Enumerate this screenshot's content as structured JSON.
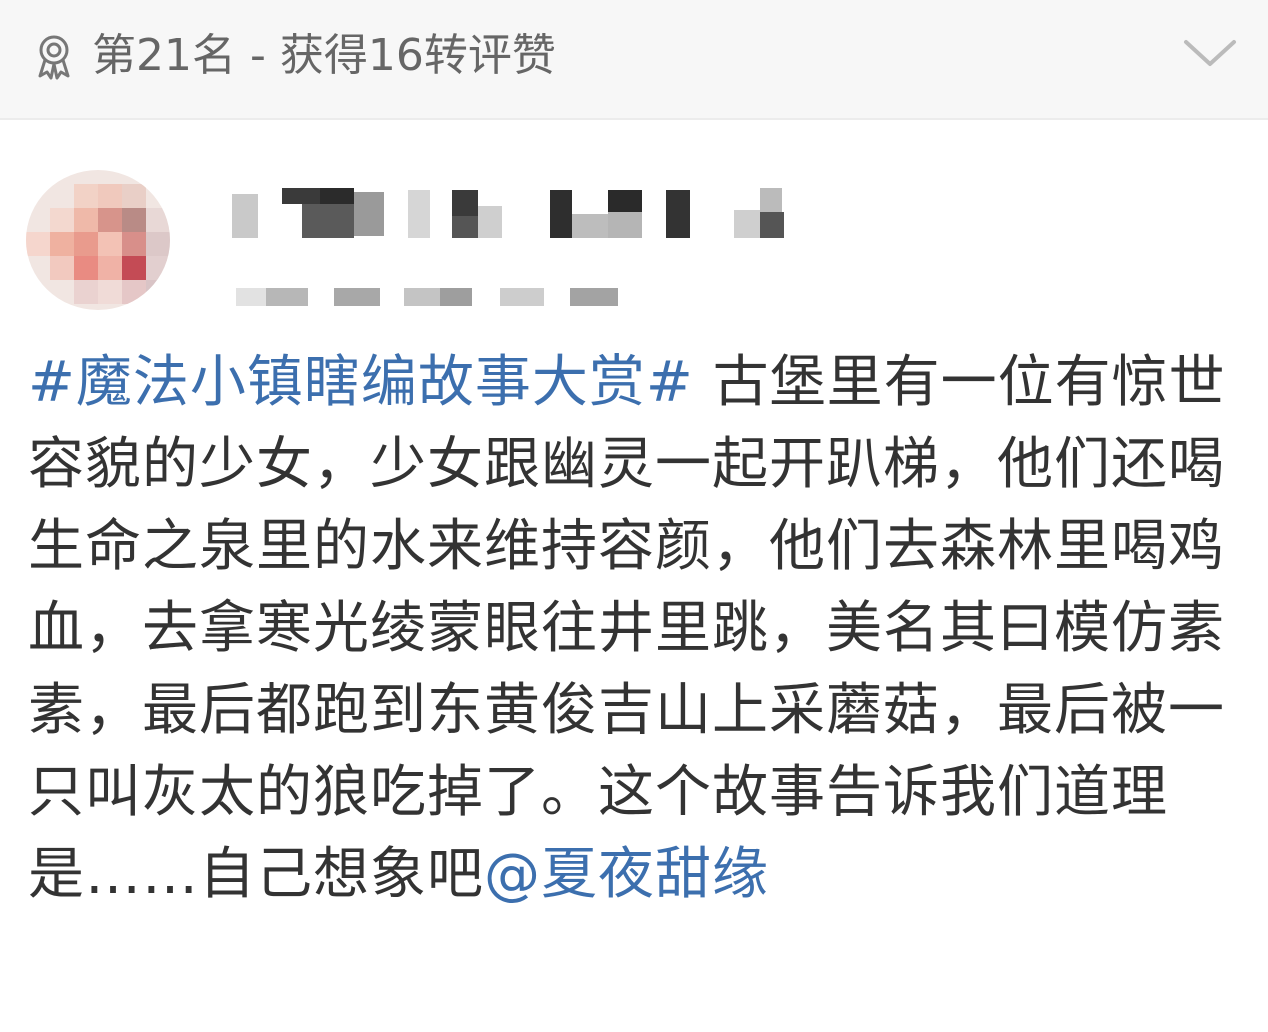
{
  "header": {
    "rank_label": "第21名 - 获得16转评赞",
    "icons": {
      "left": "ribbon-award-icon",
      "right": "chevron-down-icon"
    }
  },
  "author": {
    "nickname": "",
    "meta": "",
    "avatar": "pixelated-avatar"
  },
  "post": {
    "topic": "#魔法小镇瞎编故事大赏#",
    "body": " 古堡里有一位有惊世容貌的少女，少女跟幽灵一起开趴梯，他们还喝生命之泉里的水来维持容颜，他们去森林里喝鸡血，去拿寒光绫蒙眼往井里跳，美名其曰模仿素素，最后都跑到东黄俊吉山上采蘑菇，最后被一只叫灰太的狼吃掉了。这个故事告诉我们道理是……自己想象吧",
    "mention": "@夏夜甜缘"
  },
  "colors": {
    "link": "#3c6fae",
    "text": "#333333",
    "muted": "#666666",
    "header_bg": "#f7f7f7"
  }
}
